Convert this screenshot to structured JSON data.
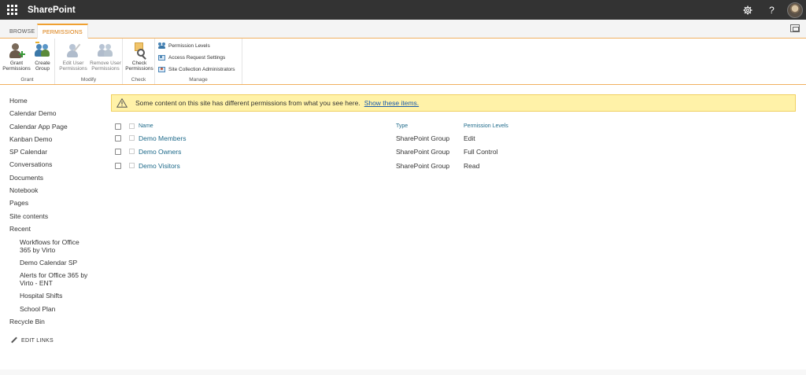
{
  "suitebar": {
    "app_name": "SharePoint",
    "icons": [
      "app-launcher-icon",
      "settings-gear-icon",
      "help-icon",
      "avatar"
    ],
    "help_label": "?"
  },
  "tabs": [
    {
      "label": "BROWSE",
      "selected": false
    },
    {
      "label": "PERMISSIONS",
      "selected": true
    }
  ],
  "ribbon": {
    "groups": {
      "grant": {
        "label": "Grant",
        "grant_permissions": "Grant Permissions",
        "create_group": "Create Group"
      },
      "modify": {
        "label": "Modify",
        "edit_user_permissions": "Edit User Permissions",
        "remove_user_permissions": "Remove User Permissions"
      },
      "check": {
        "label": "Check",
        "check_permissions": "Check Permissions"
      },
      "manage": {
        "label": "Manage",
        "permission_levels": "Permission Levels",
        "access_request_settings": "Access Request Settings",
        "site_collection_administrators": "Site Collection Administrators"
      }
    }
  },
  "leftnav": {
    "items": [
      {
        "label": "Home"
      },
      {
        "label": "Calendar Demo"
      },
      {
        "label": "Calendar App Page"
      },
      {
        "label": "Kanban Demo"
      },
      {
        "label": "SP Calendar"
      },
      {
        "label": "Conversations"
      },
      {
        "label": "Documents"
      },
      {
        "label": "Notebook"
      },
      {
        "label": "Pages"
      },
      {
        "label": "Site contents"
      },
      {
        "label": "Recent"
      }
    ],
    "recent": [
      {
        "label": "Workflows for Office 365 by Virto"
      },
      {
        "label": "Demo Calendar SP"
      },
      {
        "label": "Alerts for Office 365 by Virto - ENT"
      },
      {
        "label": "Hospital Shifts"
      },
      {
        "label": "School Plan"
      }
    ],
    "recycle_bin": "Recycle Bin",
    "edit_links": "EDIT LINKS"
  },
  "warning": {
    "message": "Some content on this site has different permissions from what you see here.",
    "link": "Show these items."
  },
  "table": {
    "headers": {
      "name": "Name",
      "type": "Type",
      "permission_levels": "Permission Levels"
    },
    "rows": [
      {
        "name": "Demo Members",
        "type": "SharePoint Group",
        "permission": "Edit"
      },
      {
        "name": "Demo Owners",
        "type": "SharePoint Group",
        "permission": "Full Control"
      },
      {
        "name": "Demo Visitors",
        "type": "SharePoint Group",
        "permission": "Read"
      }
    ]
  }
}
